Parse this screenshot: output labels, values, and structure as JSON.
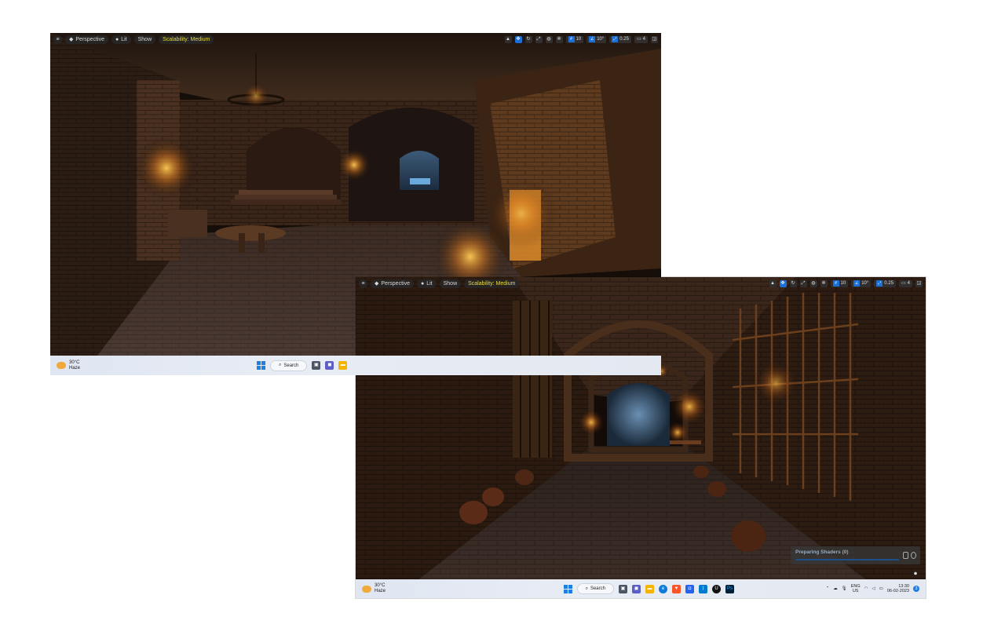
{
  "viewport": {
    "menu_icon": "hamburger-icon",
    "perspective_label": "Perspective",
    "lit_label": "Lit",
    "show_label": "Show",
    "scalability_label": "Scalability: Medium",
    "grid_value": "10",
    "angle_value": "10°",
    "scale_value": "0.25",
    "camera_speed": "4"
  },
  "taskbar_back": {
    "temperature": "30°C",
    "condition": "Haze",
    "search_label": "Search"
  },
  "taskbar_front": {
    "temperature": "30°C",
    "condition": "Haze",
    "search_label": "Search",
    "language": "ENG",
    "region": "US",
    "time": "13:30",
    "date": "06-02-2023",
    "notification_count": "3"
  },
  "shaders_popup": {
    "label": "Preparing Shaders (0)"
  },
  "colors": {
    "accent_blue": "#1c6fd6",
    "scalability_yellow": "#e8dc3c",
    "torch_orange": "#ff9a2a"
  }
}
